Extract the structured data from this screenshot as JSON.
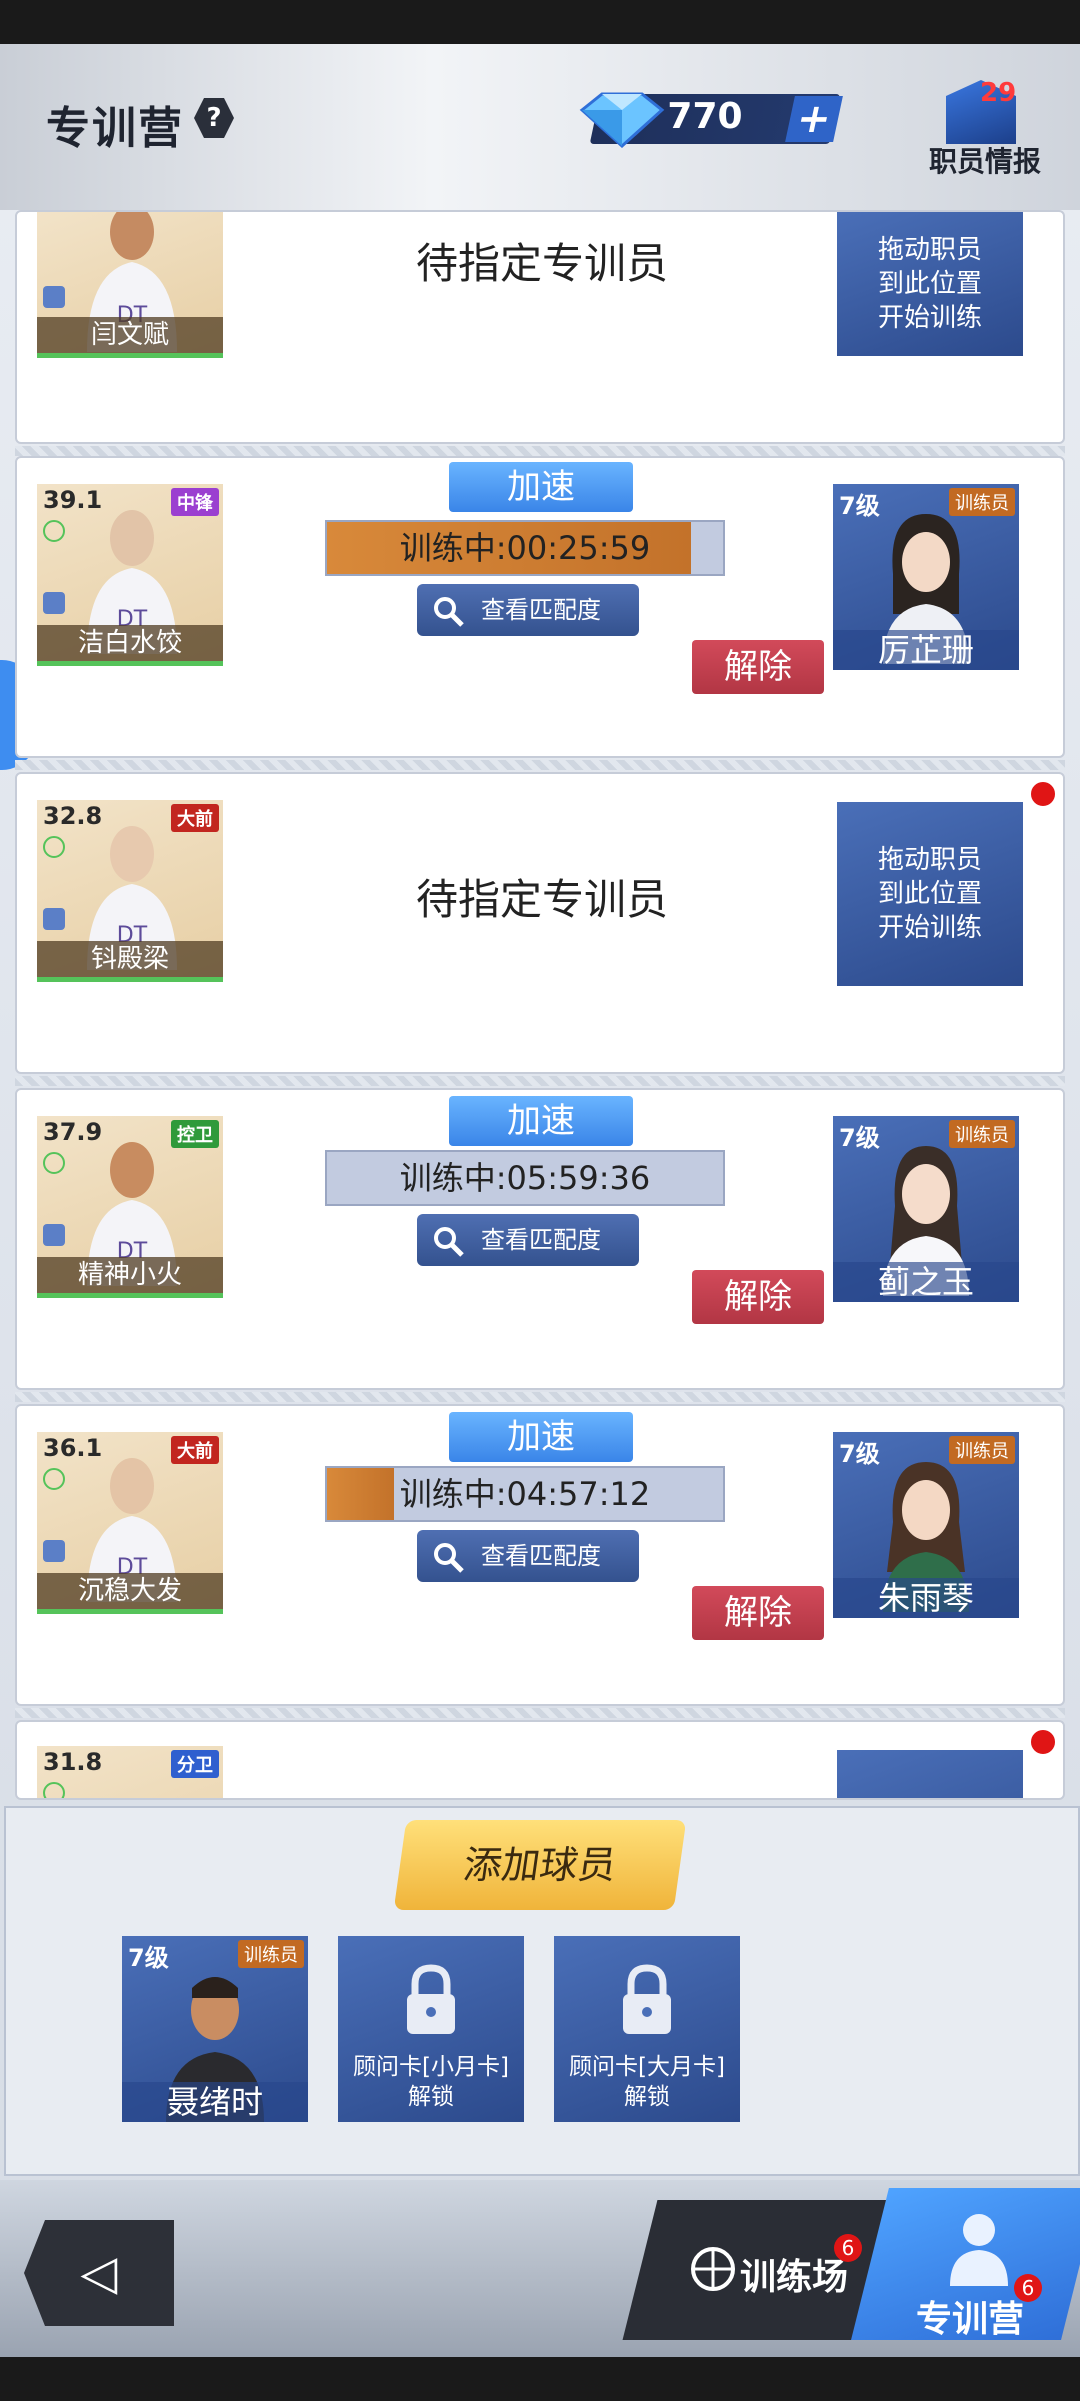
{
  "header": {
    "title": "专训营",
    "help_icon": "?",
    "currency_value": "770",
    "plus_label": "+",
    "staff_info_label": "职员情报",
    "staff_info_badge": "29"
  },
  "rows": [
    {
      "player": {
        "score": "",
        "name": "闫文赋",
        "position": ""
      },
      "pending_label": "待指定专训员",
      "drag_hint_lines": [
        "拖动职员",
        "到此位置",
        "开始训练"
      ]
    },
    {
      "player": {
        "score": "39.1",
        "name": "洁白水饺",
        "position": "中锋",
        "pos_color": "#9b3fd0"
      },
      "speed_label": "加速",
      "progress_label": "训练中:00:25:59",
      "progress_pct": 92,
      "match_label": "查看匹配度",
      "remove_label": "解除",
      "trainer": {
        "level": "7级",
        "tag": "训练员",
        "name": "厉芷珊"
      }
    },
    {
      "player": {
        "score": "32.8",
        "name": "钭殿梁",
        "position": "大前",
        "pos_color": "#c2261f"
      },
      "pending_label": "待指定专训员",
      "drag_hint_lines": [
        "拖动职员",
        "到此位置",
        "开始训练"
      ]
    },
    {
      "player": {
        "score": "37.9",
        "name": "精神小火",
        "position": "控卫",
        "pos_color": "#2f9a3a"
      },
      "speed_label": "加速",
      "progress_label": "训练中:05:59:36",
      "progress_pct": 0,
      "match_label": "查看匹配度",
      "remove_label": "解除",
      "trainer": {
        "level": "7级",
        "tag": "训练员",
        "name": "蓟之玉"
      }
    },
    {
      "player": {
        "score": "36.1",
        "name": "沉稳大发",
        "position": "大前",
        "pos_color": "#c2261f"
      },
      "speed_label": "加速",
      "progress_label": "训练中:04:57:12",
      "progress_pct": 17,
      "match_label": "查看匹配度",
      "remove_label": "解除",
      "trainer": {
        "level": "7级",
        "tag": "训练员",
        "name": "朱雨琴"
      }
    },
    {
      "player": {
        "score": "31.8",
        "name": "",
        "position": "分卫",
        "pos_color": "#2f5fcf"
      }
    }
  ],
  "bottom": {
    "add_player_label": "添加球员",
    "slots": [
      {
        "level": "7级",
        "tag": "训练员",
        "name": "聂绪时"
      },
      {
        "label_line1": "顾问卡[小月卡]",
        "label_line2": "解锁"
      },
      {
        "label_line1": "顾问卡[大月卡]",
        "label_line2": "解锁"
      }
    ]
  },
  "nav": {
    "back_label": "◁",
    "tab_practice": "训练场",
    "tab_practice_badge": "6",
    "tab_camp": "专训营",
    "tab_camp_badge": "6"
  }
}
